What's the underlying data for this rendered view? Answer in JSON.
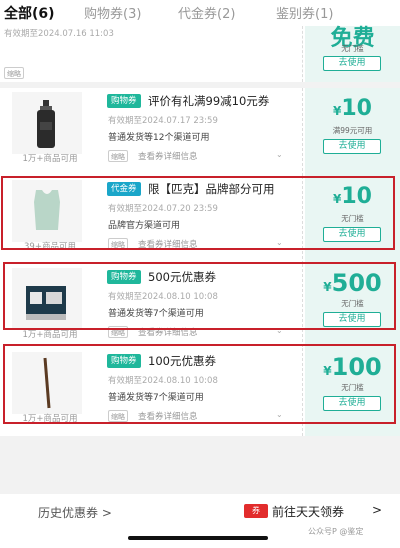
{
  "tabs": [
    {
      "label": "全部(6)"
    },
    {
      "label": "购物券(3)"
    },
    {
      "label": "代金券(2)"
    },
    {
      "label": "鉴别券(1)"
    }
  ],
  "top_card": {
    "expiry": "有效期至2024.07.16 11:03",
    "amount": "免费",
    "condition": "无门槛",
    "use_label": "去使用",
    "tag": "缩略"
  },
  "coupons": [
    {
      "badge": "购物券",
      "title": "评价有礼满99减10元券",
      "expiry": "有效期至2024.07.17 23:59",
      "desc": "普通发货等12个渠道可用",
      "tag": "缩略",
      "details_label": "查看券详细信息",
      "available": "1万+商品可用",
      "yen": "¥",
      "amount": "10",
      "condition": "满99元可用",
      "use_label": "去使用",
      "product_icon": "shampoo-bottle-icon"
    },
    {
      "badge": "代金券",
      "title": "限【匹克】品牌部分可用",
      "expiry": "有效期至2024.07.20 23:59",
      "desc": "品牌官方渠道可用",
      "tag": "缩略",
      "details_label": "查看券详细信息",
      "available": "39+商品可用",
      "yen": "¥",
      "amount": "10",
      "condition": "无门槛",
      "use_label": "去使用",
      "product_icon": "tank-top-icon"
    },
    {
      "badge": "购物券",
      "title": "500元优惠券",
      "expiry": "有效期至2024.08.10 10:08",
      "desc": "普通发货等7个渠道可用",
      "tag": "缩略",
      "details_label": "查看券详细信息",
      "available": "1万+商品可用",
      "yen": "¥",
      "amount": "500",
      "condition": "无门槛",
      "use_label": "去使用",
      "product_icon": "gift-box-icon"
    },
    {
      "badge": "购物券",
      "title": "100元优惠券",
      "expiry": "有效期至2024.08.10 10:08",
      "desc": "普通发货等7个渠道可用",
      "tag": "缩略",
      "details_label": "查看券详细信息",
      "available": "1万+商品可用",
      "yen": "¥",
      "amount": "100",
      "condition": "无门槛",
      "use_label": "去使用",
      "product_icon": "stick-icon"
    }
  ],
  "footer": {
    "history_label": "历史优惠券 >",
    "go_icon_text": "券",
    "go_label": "前往天天领券",
    "go_arrow": ">",
    "watermark": "公众号P @鉴定"
  },
  "colors": {
    "accent": "#1fae96",
    "badge_green": "#1fb79b",
    "badge_blue": "#1aa6c9",
    "highlight_red": "#c8202a",
    "go_red": "#e22c2c"
  }
}
